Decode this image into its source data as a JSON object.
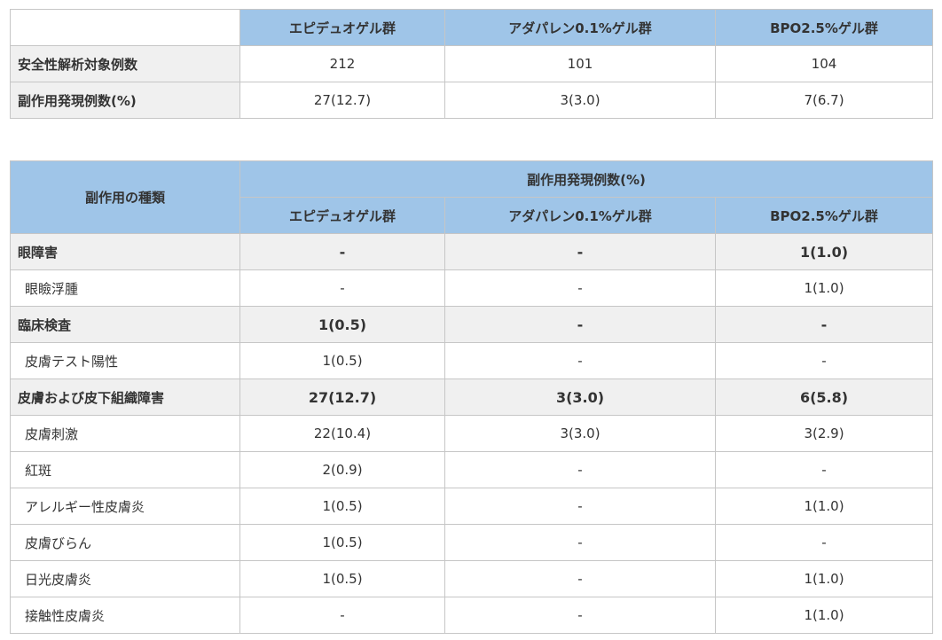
{
  "summary": {
    "headers": [
      "",
      "エピデュオゲル群",
      "アダパレン0.1%ゲル群",
      "BPO2.5%ゲル群"
    ],
    "rows": [
      {
        "label": "安全性解析対象例数",
        "values": [
          "212",
          "101",
          "104"
        ]
      },
      {
        "label": "副作用発現例数(%)",
        "values": [
          "27(12.7)",
          "3(3.0)",
          "7(6.7)"
        ]
      }
    ]
  },
  "detail": {
    "type_header": "副作用の種類",
    "group_header": "副作用発現例数(%)",
    "columns": [
      "エピデュオゲル群",
      "アダパレン0.1%ゲル群",
      "BPO2.5%ゲル群"
    ],
    "rows": [
      {
        "kind": "category",
        "label": "眼障害",
        "values": [
          "-",
          "-",
          "1(1.0)"
        ]
      },
      {
        "kind": "item",
        "label": "眼瞼浮腫",
        "values": [
          "-",
          "-",
          "1(1.0)"
        ]
      },
      {
        "kind": "category",
        "label": "臨床検査",
        "values": [
          "1(0.5)",
          "-",
          "-"
        ]
      },
      {
        "kind": "item",
        "label": "皮膚テスト陽性",
        "values": [
          "1(0.5)",
          "-",
          "-"
        ]
      },
      {
        "kind": "category",
        "label": "皮膚および皮下組織障害",
        "values": [
          "27(12.7)",
          "3(3.0)",
          "6(5.8)"
        ]
      },
      {
        "kind": "item",
        "label": "皮膚刺激",
        "values": [
          "22(10.4)",
          "3(3.0)",
          "3(2.9)"
        ]
      },
      {
        "kind": "item",
        "label": "紅斑",
        "values": [
          "2(0.9)",
          "-",
          "-"
        ]
      },
      {
        "kind": "item",
        "label": "アレルギー性皮膚炎",
        "values": [
          "1(0.5)",
          "-",
          "1(1.0)"
        ]
      },
      {
        "kind": "item",
        "label": "皮膚びらん",
        "values": [
          "1(0.5)",
          "-",
          "-"
        ]
      },
      {
        "kind": "item",
        "label": "日光皮膚炎",
        "values": [
          "1(0.5)",
          "-",
          "1(1.0)"
        ]
      },
      {
        "kind": "item",
        "label": "接触性皮膚炎",
        "values": [
          "-",
          "-",
          "1(1.0)"
        ]
      }
    ]
  }
}
